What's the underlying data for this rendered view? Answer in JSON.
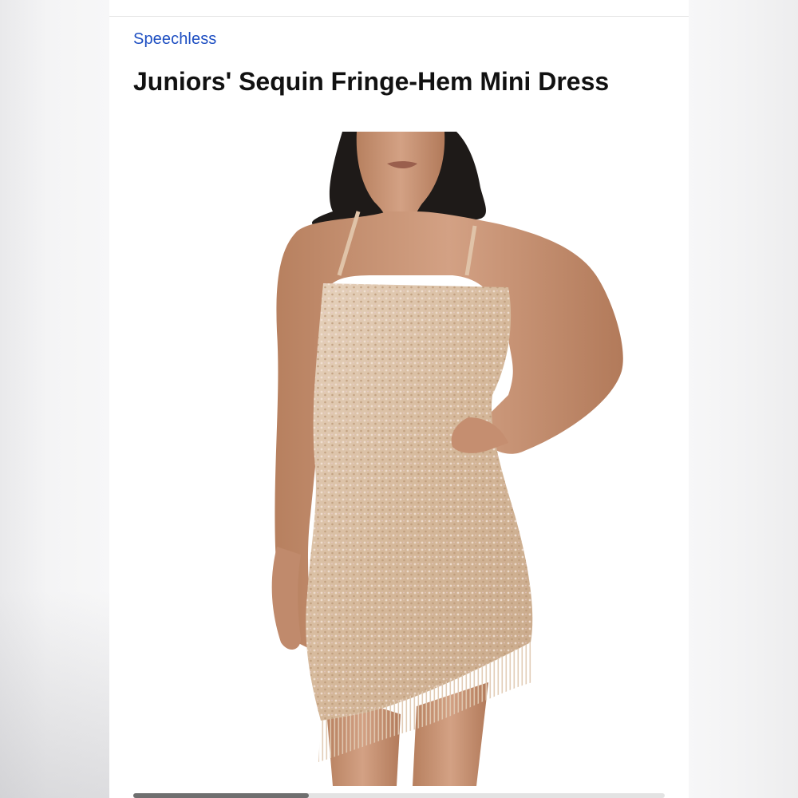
{
  "product": {
    "brand": "Speechless",
    "title": "Juniors' Sequin Fringe-Hem Mini Dress"
  },
  "gallery": {
    "image_alt": "Model wearing sequin fringe-hem mini dress",
    "scroll_progress": 0.33
  },
  "colors": {
    "brand_link": "#1e4fc2",
    "dress": "#d9bfa2",
    "skin": "#c99576",
    "hair": "#1e1a18"
  },
  "icons": []
}
